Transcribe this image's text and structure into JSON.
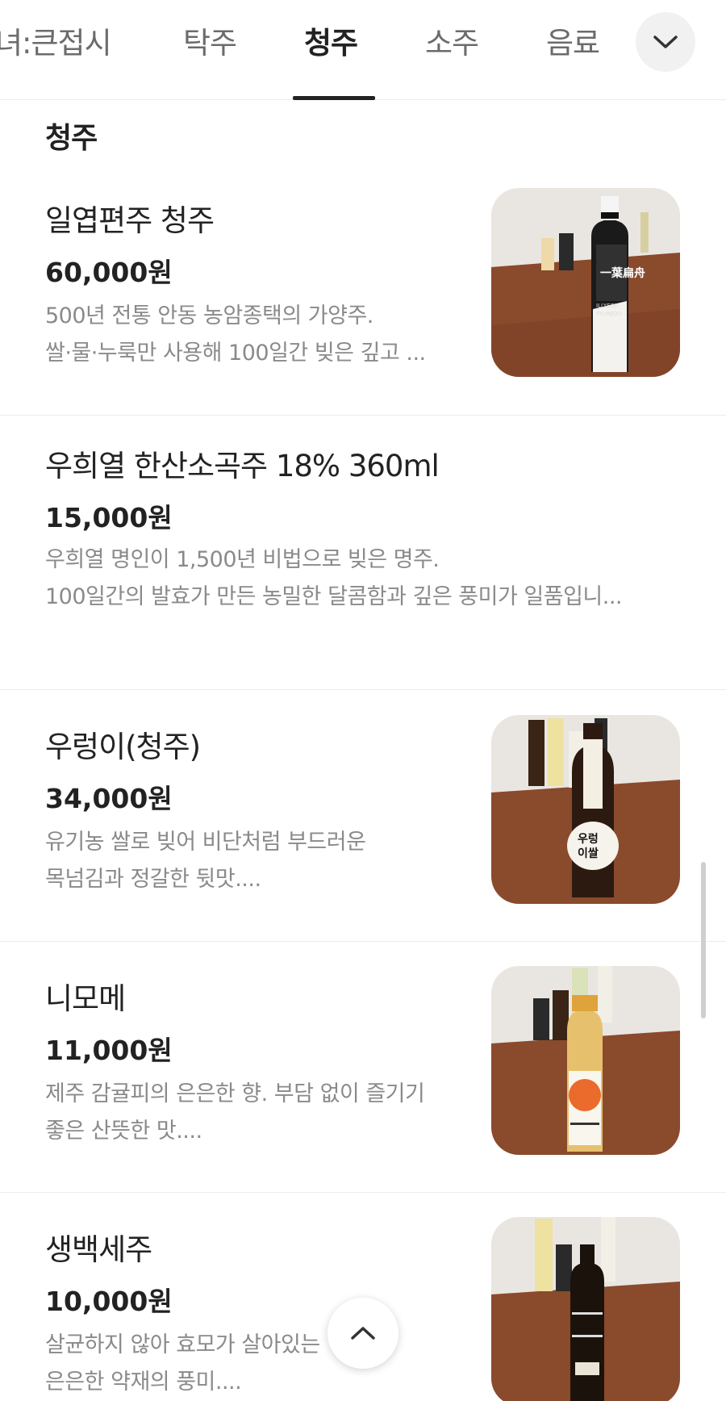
{
  "tabs": [
    {
      "label": "녀:큰접시",
      "active": false
    },
    {
      "label": "탁주",
      "active": false
    },
    {
      "label": "청주",
      "active": true
    },
    {
      "label": "소주",
      "active": false
    },
    {
      "label": "음료",
      "active": false
    }
  ],
  "tab_expand_icon": "chevron-down-icon",
  "section": {
    "title": "청주"
  },
  "items": [
    {
      "name": "일엽편주 청주",
      "price": "60,000원",
      "desc_line1": "500년 전통 안동 농암종택의 가양주.",
      "desc_line2": "쌀·물·누룩만 사용해 100일간 빚은 깊고 ...",
      "has_image": true
    },
    {
      "name": "우희열 한산소곡주 18% 360ml",
      "price": "15,000원",
      "desc_line1": "우희열 명인이 1,500년 비법으로 빚은 명주.",
      "desc_line2": "100일간의 발효가 만든 농밀한 달콤함과 깊은 풍미가 일품입니...",
      "has_image": false
    },
    {
      "name": "우렁이(청주)",
      "price": "34,000원",
      "desc_line1": "유기농 쌀로 빚어 비단처럼 부드러운",
      "desc_line2": "목넘김과 정갈한 뒷맛....",
      "has_image": true
    },
    {
      "name": "니모메",
      "price": "11,000원",
      "desc_line1": "제주 감귤피의 은은한 향. 부담 없이 즐기기",
      "desc_line2": "좋은 산뜻한 맛....",
      "has_image": true
    },
    {
      "name": "생백세주",
      "price": "10,000원",
      "desc_line1": "살균하지 않아 효모가 살아있는 ",
      "desc_line2": "은은한 약재의 풍미....",
      "has_image": true
    }
  ],
  "image_labels": {
    "item1": [
      "一葉扁舟",
      "ILLYEOP",
      "PYUNJOO"
    ],
    "item3": [
      "우렁",
      "이쌀"
    ]
  },
  "scroll_top_icon": "chevron-up-icon",
  "colors": {
    "text_primary": "#222222",
    "text_secondary": "#8a8a8a",
    "divider": "#ececec",
    "table_wood": "#8a4a2c"
  }
}
